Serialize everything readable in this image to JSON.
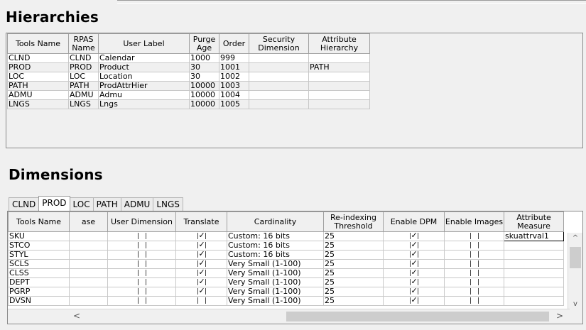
{
  "hierarchies": {
    "title": "Hierarchies",
    "columns": [
      "Tools Name",
      "RPAS Name",
      "User Label",
      "Purge Age",
      "Order",
      "Security Dimension",
      "Attribute Hierarchy"
    ],
    "rows": [
      {
        "tools": "CLND",
        "rpas": "CLND",
        "label": "Calendar",
        "purge": "1000",
        "order": "999",
        "security": "",
        "attr": ""
      },
      {
        "tools": "PROD",
        "rpas": "PROD",
        "label": "Product",
        "purge": "30",
        "order": "1001",
        "security": "",
        "attr": "PATH"
      },
      {
        "tools": "LOC",
        "rpas": "LOC",
        "label": "Location",
        "purge": "30",
        "order": "1002",
        "security": "",
        "attr": ""
      },
      {
        "tools": "PATH",
        "rpas": "PATH",
        "label": "ProdAttrHier",
        "purge": "10000",
        "order": "1003",
        "security": "",
        "attr": ""
      },
      {
        "tools": "ADMU",
        "rpas": "ADMU",
        "label": "Admu",
        "purge": "10000",
        "order": "1004",
        "security": "",
        "attr": ""
      },
      {
        "tools": "LNGS",
        "rpas": "LNGS",
        "label": "Lngs",
        "purge": "10000",
        "order": "1005",
        "security": "",
        "attr": ""
      }
    ]
  },
  "dimensions": {
    "title": "Dimensions",
    "tabs": [
      "CLND",
      "PROD",
      "LOC",
      "PATH",
      "ADMU",
      "LNGS"
    ],
    "active_tab": "PROD",
    "columns": [
      "Tools Name",
      "ase",
      "User Dimension",
      "Translate",
      "Cardinality",
      "Re-indexing Threshold",
      "Enable DPM",
      "Enable Images",
      "Attribute Measure"
    ],
    "rows": [
      {
        "tools": "SKU",
        "base": "",
        "user_dim": false,
        "translate": true,
        "card": "Custom: 16 bits",
        "reindex": "25",
        "dpm": true,
        "images": false,
        "attr": "skuattrval1"
      },
      {
        "tools": "STCO",
        "base": "",
        "user_dim": false,
        "translate": true,
        "card": "Custom: 16 bits",
        "reindex": "25",
        "dpm": true,
        "images": false,
        "attr": ""
      },
      {
        "tools": "STYL",
        "base": "",
        "user_dim": false,
        "translate": true,
        "card": "Custom: 16 bits",
        "reindex": "25",
        "dpm": true,
        "images": false,
        "attr": ""
      },
      {
        "tools": "SCLS",
        "base": "",
        "user_dim": false,
        "translate": true,
        "card": "Very Small (1-100)",
        "reindex": "25",
        "dpm": true,
        "images": false,
        "attr": ""
      },
      {
        "tools": "CLSS",
        "base": "",
        "user_dim": false,
        "translate": true,
        "card": "Very Small (1-100)",
        "reindex": "25",
        "dpm": true,
        "images": false,
        "attr": ""
      },
      {
        "tools": "DEPT",
        "base": "",
        "user_dim": false,
        "translate": true,
        "card": "Very Small (1-100)",
        "reindex": "25",
        "dpm": true,
        "images": false,
        "attr": ""
      },
      {
        "tools": "PGRP",
        "base": "",
        "user_dim": false,
        "translate": true,
        "card": "Very Small (1-100)",
        "reindex": "25",
        "dpm": true,
        "images": false,
        "attr": ""
      },
      {
        "tools": "DVSN",
        "base": "",
        "user_dim": false,
        "translate": false,
        "card": "Very Small (1-100)",
        "reindex": "25",
        "dpm": true,
        "images": false,
        "attr": ""
      }
    ]
  },
  "icons": {
    "scroll_up": "chevron-up-icon",
    "scroll_down": "chevron-down-icon",
    "scroll_left": "chevron-left-icon",
    "scroll_right": "chevron-right-icon",
    "check": "check-icon"
  },
  "glyphs": {
    "up": "^",
    "down": "v",
    "left": "<",
    "right": ">",
    "check": "✓"
  }
}
